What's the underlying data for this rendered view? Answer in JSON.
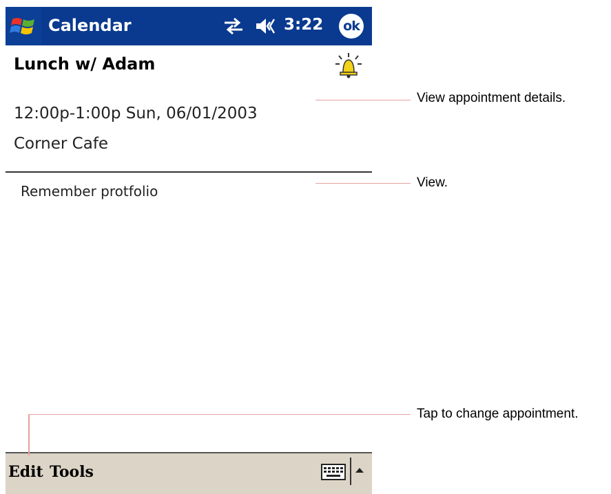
{
  "titlebar": {
    "app_title": "Calendar",
    "clock": "3:22",
    "ok_label": "ok",
    "icons": [
      "windows-start-icon",
      "connectivity-icon",
      "volume-icon"
    ]
  },
  "appointment": {
    "subject": "Lunch w/ Adam",
    "when": "12:00p-1:00p Sun, 06/01/2003",
    "where": "Corner Cafe",
    "notes": "Remember protfolio",
    "reminder_icon": "reminder-bell-icon"
  },
  "menubar": {
    "edit_label": "Edit",
    "tools_label": "Tools",
    "icons": [
      "keyboard-icon",
      "sip-arrow-up-icon"
    ]
  },
  "callouts": {
    "details": "View appointment details.",
    "view": "View.",
    "edit": "Tap to change appointment."
  },
  "colors": {
    "titlebar_bg": "#0a3a8f",
    "menubar_bg": "#dcd4c6",
    "callout_line": "#e8a0a0"
  }
}
